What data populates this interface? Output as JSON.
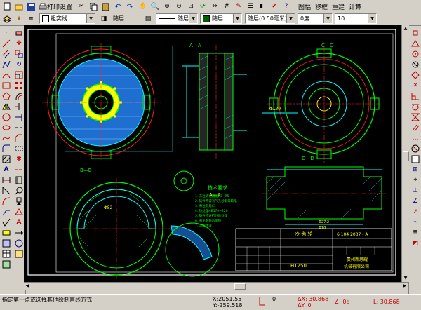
{
  "toolbar_top": {
    "print_settings": "打印设置",
    "zoom": "图幅",
    "move_frame": "移框",
    "rebuild": "重建",
    "calc": "计算"
  },
  "props": {
    "linetype": "粗实线",
    "layer1": "随层",
    "linestyle": "随层",
    "color": "随层",
    "lineweight": "随层(0.50毫米)",
    "angle": "0度",
    "size": "10"
  },
  "drawing": {
    "section_aa": "A—A",
    "section_cc": "C—C",
    "section_bb": "B—B",
    "section_dd": "D—D",
    "tech_req_title": "技术要求",
    "tech_lines": [
      "1. 未注铸造圆角R3~R5",
      "2. 铸件不得有气孔砂眼等缺陷",
      "3. 未注倒角C1",
      "4. 热处理HB170~220",
      "5. 铸件应进行时效处理",
      "6. 去毛刺锐边倒钝",
      "7. 涂防锈漆"
    ],
    "title_name": "冷 齿 轮",
    "title_code": "6 104 2037 - A",
    "material": "HT250",
    "company_1": "贵州新思耀",
    "company_2": "机械有限公司",
    "dims": [
      "Φ52",
      "40",
      "25",
      "R3",
      "Φ170",
      "112",
      "Φ27.2",
      "Φ18",
      "Φ20",
      "8"
    ]
  },
  "status": {
    "prompt": "指定第一点或选择其他绘制直线方式",
    "x": "X:2051.55",
    "y": "Y:-259.518",
    "zero": "0",
    "dx": "ΔX: 30.868",
    "dy": "ΔY: 0",
    "angle": "∠: 0d",
    "len": "L: 30.868"
  },
  "colors": {
    "accent": "#000080",
    "green": "#00ff00",
    "cyan": "#00ffff",
    "yellow": "#ffff00",
    "red": "#ff0000",
    "blue": "#0080ff",
    "magenta": "#ff00ff"
  }
}
